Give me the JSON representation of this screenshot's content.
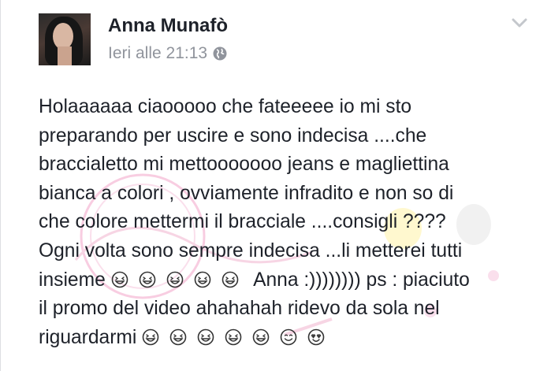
{
  "post": {
    "author": "Anna Munafò",
    "timestamp": "Ieri alle 21:13",
    "privacy_icon": "globe-icon",
    "menu_icon": "chevron-down-icon",
    "lines": [
      "Holaaaaaa ciaooooo che fateeeee io mi sto",
      "preparando per uscire e sono indecisa ....che",
      "braccialetto mi mettooooooo jeans e magliettina",
      "bianca a colori , ovviamente infradito e non so di",
      "che colore mettermi il bracciale ....consigli ????",
      "Ogni volta sono sempre indecisa ...li metterei tutti"
    ],
    "line7_start": "insieme",
    "line7_end": "Anna :)))))))) ps : piaciuto",
    "line8": "il promo del video ahahahah ridevo da sola nel",
    "line9_start": "riguardarmi",
    "line7_emojis": [
      "grin-emoji",
      "grin-emoji",
      "grin-emoji",
      "grin-emoji",
      "grin-emoji"
    ],
    "line9_emojis": [
      "grin-emoji",
      "grin-emoji",
      "grin-emoji",
      "grin-emoji",
      "grin-emoji",
      "smile-emoji",
      "heart-eyes-emoji"
    ]
  },
  "colors": {
    "text": "#1d2129",
    "meta": "#90949c",
    "emoji_outline": "#333333"
  }
}
